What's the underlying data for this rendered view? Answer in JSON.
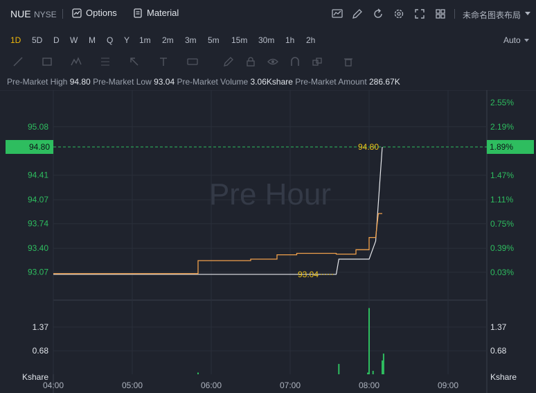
{
  "header": {
    "symbol": "NUE",
    "exchange": "NYSE",
    "options_label": "Options",
    "material_label": "Material",
    "layout_name": "未命名图表布局",
    "icons": [
      "indicator-icon",
      "draw-icon",
      "refresh-icon",
      "settings-icon",
      "fullscreen-icon",
      "layout-grid-icon",
      "chevron-down-icon"
    ]
  },
  "periods": {
    "items": [
      "1D",
      "5D",
      "D",
      "W",
      "M",
      "Q",
      "Y",
      "1m",
      "2m",
      "3m",
      "5m",
      "15m",
      "30m",
      "1h",
      "2h"
    ],
    "active": "1D",
    "scale_mode": "Auto"
  },
  "info": {
    "high_label": "Pre-Market High",
    "high_value": "94.80",
    "low_label": "Pre-Market Low",
    "low_value": "93.04",
    "volume_label": "Pre-Market Volume",
    "volume_value": "3.06Kshare",
    "amount_label": "Pre-Market Amount",
    "amount_value": "286.67K"
  },
  "chart": {
    "watermark": "Pre Hour",
    "colors": {
      "background": "#1f232d",
      "price_line": "#f0a04b",
      "avg_line": "#e6e8ec",
      "up": "#2ebd5f",
      "dash": "#2ebd5f",
      "label_yellow": "#f0c419"
    },
    "price_ticks": [
      "95.08",
      "94.41",
      "94.07",
      "93.74",
      "93.40",
      "93.07"
    ],
    "percent_ticks": [
      "2.55%",
      "2.19%",
      "1.47%",
      "1.11%",
      "0.75%",
      "0.39%",
      "0.03%"
    ],
    "current_price": "94.80",
    "current_percent": "1.89%",
    "high_marker": "94.80",
    "low_marker": "93.04",
    "volume_ticks": [
      "1.37",
      "0.68"
    ],
    "volume_unit": "Kshare",
    "time_ticks": [
      "04:00",
      "05:00",
      "06:00",
      "07:00",
      "08:00",
      "09:00"
    ]
  },
  "chart_data": {
    "type": "line",
    "x_range": [
      "04:00",
      "09:30"
    ],
    "y_range": [
      93.0,
      95.3
    ],
    "series": [
      {
        "points": [
          [
            "04:00",
            93.05
          ],
          [
            "05:50",
            93.05
          ],
          [
            "05:50",
            93.23
          ],
          [
            "06:30",
            93.23
          ],
          [
            "06:30",
            93.25
          ],
          [
            "06:50",
            93.25
          ],
          [
            "06:50",
            93.31
          ],
          [
            "07:05",
            93.31
          ],
          [
            "07:05",
            93.33
          ],
          [
            "07:35",
            93.33
          ],
          [
            "07:35",
            93.32
          ],
          [
            "07:50",
            93.32
          ],
          [
            "07:50",
            93.38
          ],
          [
            "08:00",
            93.38
          ],
          [
            "08:00",
            93.55
          ],
          [
            "08:05",
            93.55
          ],
          [
            "08:07",
            93.88
          ],
          [
            "08:10",
            93.88
          ]
        ]
      },
      {
        "points": [
          [
            "04:00",
            93.04
          ],
          [
            "07:35",
            93.04
          ],
          [
            "07:37",
            93.25
          ],
          [
            "08:00",
            93.25
          ],
          [
            "08:05",
            93.5
          ],
          [
            "08:10",
            94.8
          ]
        ]
      }
    ],
    "volume": {
      "unit": "Kshare",
      "ylim": [
        0,
        2.05
      ],
      "points": [
        [
          "05:50",
          0.05
        ],
        [
          "07:37",
          0.3
        ],
        [
          "07:59",
          0.05
        ],
        [
          "08:00",
          1.92
        ],
        [
          "08:03",
          0.1
        ],
        [
          "08:10",
          0.4
        ],
        [
          "08:11",
          0.6
        ]
      ]
    }
  }
}
